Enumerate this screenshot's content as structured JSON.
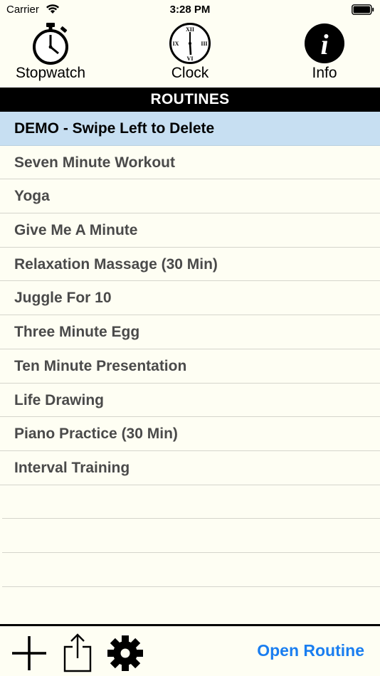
{
  "status_bar": {
    "carrier": "Carrier",
    "time": "3:28 PM"
  },
  "top_nav": {
    "items": [
      {
        "label": "Stopwatch",
        "icon": "stopwatch-icon"
      },
      {
        "label": "Clock",
        "icon": "clock-icon"
      },
      {
        "label": "Info",
        "icon": "info-icon"
      }
    ],
    "clock_numerals": {
      "top": "XII",
      "right": "III",
      "bottom": "VI",
      "left": "IX"
    },
    "info_glyph": "i"
  },
  "section": {
    "title": "ROUTINES"
  },
  "routines": [
    {
      "label": "DEMO - Swipe Left to Delete",
      "selected": true
    },
    {
      "label": "Seven Minute Workout"
    },
    {
      "label": "Yoga"
    },
    {
      "label": "Give Me A Minute"
    },
    {
      "label": "Relaxation Massage (30 Min)"
    },
    {
      "label": "Juggle For 10"
    },
    {
      "label": "Three Minute Egg"
    },
    {
      "label": "Ten Minute Presentation"
    },
    {
      "label": "Life Drawing"
    },
    {
      "label": "Piano Practice (30 Min)"
    },
    {
      "label": "Interval Training"
    }
  ],
  "toolbar": {
    "add_icon": "plus-icon",
    "share_icon": "share-icon",
    "settings_icon": "gear-icon",
    "open_label": "Open Routine"
  },
  "colors": {
    "background": "#fefef3",
    "selected_row": "#c7dff2",
    "accent": "#1a7ef0",
    "header_bg": "#000000",
    "row_text": "#4a4a4a"
  }
}
